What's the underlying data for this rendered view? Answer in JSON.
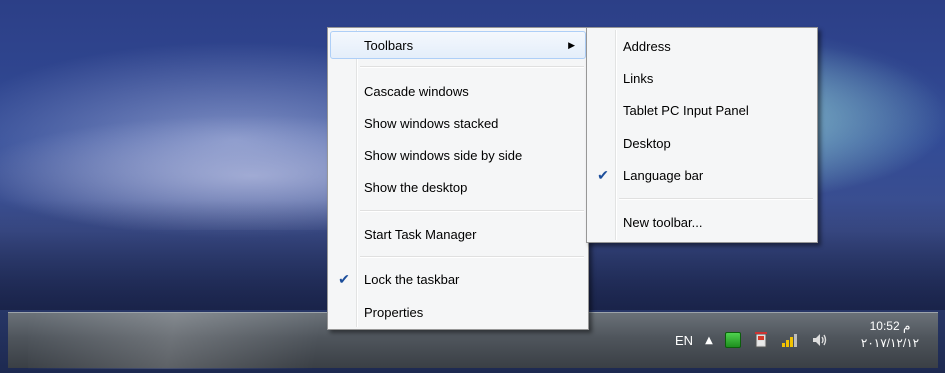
{
  "context_menu": {
    "items": [
      {
        "label": "Toolbars",
        "submenu": true,
        "highlighted": true
      },
      {
        "label": "Cascade windows"
      },
      {
        "label": "Show windows stacked"
      },
      {
        "label": "Show windows side by side"
      },
      {
        "label": "Show the desktop"
      },
      {
        "label": "Start Task Manager"
      },
      {
        "label": "Lock the taskbar",
        "checked": true
      },
      {
        "label": "Properties"
      }
    ]
  },
  "toolbars_submenu": {
    "items": [
      {
        "label": "Address"
      },
      {
        "label": "Links"
      },
      {
        "label": "Tablet PC Input Panel"
      },
      {
        "label": "Desktop"
      },
      {
        "label": "Language bar",
        "checked": true
      },
      {
        "label": "New toolbar..."
      }
    ]
  },
  "tray": {
    "language": "EN",
    "show_hidden_icon": "triangle-up-icon",
    "icons": [
      "network-device-icon",
      "battery-power-icon",
      "network-signal-icon",
      "volume-icon"
    ]
  },
  "clock": {
    "time": "10:52 م",
    "date": "٢٠١٧/١٢/١٢"
  },
  "colors": {
    "check": "#1c4e9b",
    "highlight_border": "#aecff7",
    "menu_bg": "#f5f6f7"
  }
}
